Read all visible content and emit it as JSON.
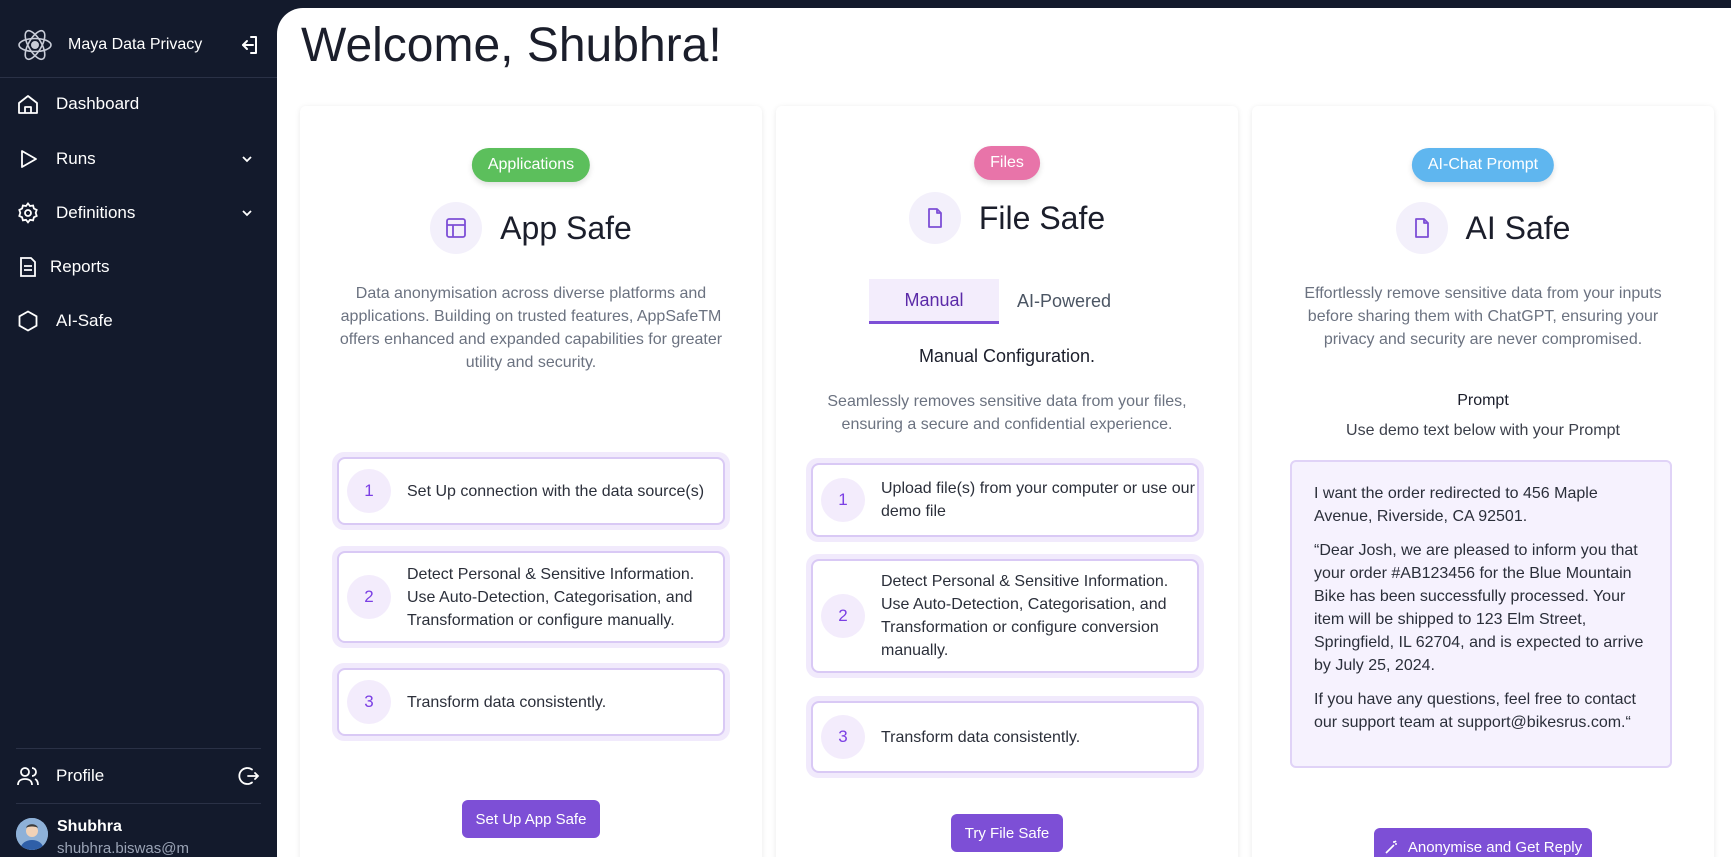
{
  "sidebar": {
    "brand": "Maya Data Privacy",
    "nav": [
      {
        "label": "Dashboard"
      },
      {
        "label": "Runs"
      },
      {
        "label": "Definitions"
      },
      {
        "label": "Reports"
      },
      {
        "label": "AI-Safe"
      }
    ],
    "profile_label": "Profile",
    "user": {
      "name": "Shubhra",
      "email": "shubhra.biswas@m"
    }
  },
  "main": {
    "title": "Welcome, Shubhra!",
    "cards": [
      {
        "tag": "Applications",
        "tag_color": "#5cbf5c",
        "title": "App Safe",
        "description": "Data anonymisation across diverse platforms and applications. Building on trusted features, AppSafeTM offers enhanced and expanded capabilities for greater utility and security.",
        "steps": [
          {
            "num": "1",
            "text": "Set Up connection with the data source(s)"
          },
          {
            "num": "2",
            "text": "Detect Personal & Sensitive Information. Use Auto-Detection, Categorisation, and Transformation or configure manually."
          },
          {
            "num": "3",
            "text": "Transform data consistently."
          }
        ],
        "button": "Set Up App Safe"
      },
      {
        "tag": "Files",
        "tag_color": "#e874a9",
        "title": "File Safe",
        "tabs": [
          "Manual",
          "AI-Powered"
        ],
        "subheading": "Manual Configuration.",
        "description": "Seamlessly removes sensitive data from your files, ensuring a secure and confidential experience.",
        "steps": [
          {
            "num": "1",
            "text": "Upload file(s) from your computer or use our demo file"
          },
          {
            "num": "2",
            "text": "Detect Personal & Sensitive Information. Use Auto-Detection, Categorisation, and Transformation or configure conversion manually."
          },
          {
            "num": "3",
            "text": "Transform data consistently."
          }
        ],
        "button": "Try File Safe"
      },
      {
        "tag": "AI-Chat Prompt",
        "tag_color": "#5fb6ef",
        "title": "AI Safe",
        "description": "Effortlessly remove sensitive data from your inputs before sharing them with ChatGPT, ensuring your privacy and security are never compromised.",
        "prompt_label": "Prompt",
        "prompt_hint": "Use demo text below with your Prompt",
        "demo_paragraphs": [
          "I want the order redirected to 456 Maple Avenue, Riverside, CA 92501.",
          "“Dear Josh, we are pleased to inform you that your order #AB123456 for the Blue Mountain Bike has been successfully processed. Your item will be shipped to 123 Elm Street, Springfield, IL 62704, and is expected to arrive by July 25, 2024.",
          "If you have any questions, feel free to contact our support team at support@bikesrus.com.“"
        ],
        "button": "Anonymise and Get Reply"
      }
    ]
  }
}
